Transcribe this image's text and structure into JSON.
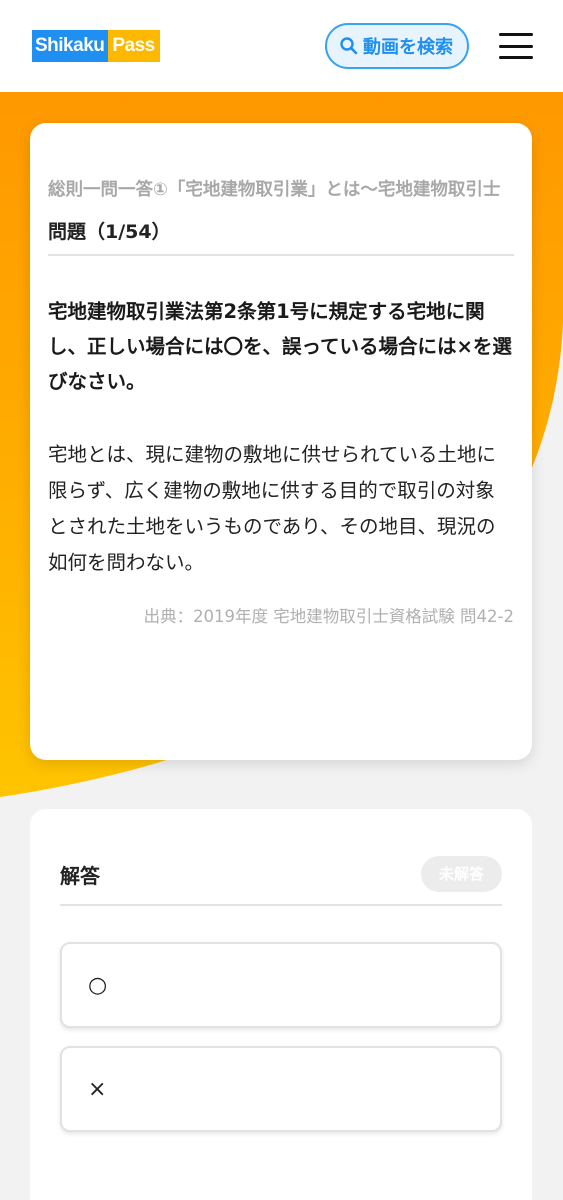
{
  "header": {
    "logo_part1": "Shikaku",
    "logo_part2": "Pass",
    "search_label": "動画を検索",
    "search_icon": "search-icon",
    "menu_icon": "hamburger-menu-icon"
  },
  "colors": {
    "brand_blue": "#1f8ff2",
    "brand_yellow": "#ffb800",
    "hero_orange": "#ffa000",
    "page_bg": "#f2f2f2"
  },
  "question": {
    "category": "総則一問一答①「宅地建物取引業」とは〜宅地建物取引士",
    "number": "問題（1/54）",
    "instruction": "宅地建物取引業法第2条第1号に規定する宅地に関し、正しい場合には〇を、誤っている場合には×を選びなさい。",
    "statement": "宅地とは、現に建物の敷地に供せられている土地に限らず、広く建物の敷地に供する目的で取引の対象とされた土地をいうものであり、その地目、現況の如何を問わない。",
    "source": "出典：2019年度 宅地建物取引士資格試験 問42-2"
  },
  "answer": {
    "title": "解答",
    "status_badge": "未解答",
    "choices": [
      {
        "label": "○"
      },
      {
        "label": "×"
      }
    ]
  }
}
